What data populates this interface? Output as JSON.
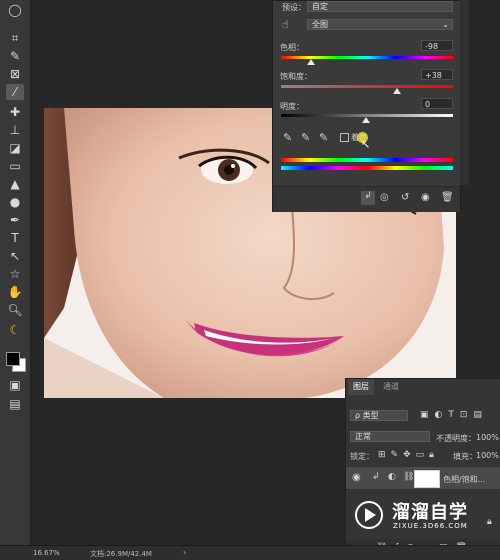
{
  "properties": {
    "preset_label": "预设：",
    "preset_value": "自定",
    "channel_value": "全图",
    "hue_label": "色相：",
    "hue_value": "-98",
    "saturation_label": "饱和度：",
    "saturation_value": "+38",
    "lightness_label": "明度：",
    "lightness_value": "0",
    "colorize_label": "着色"
  },
  "layers": {
    "tab_layers": "图层",
    "tab_channels": "通道",
    "filter_kind": "ρ 类型",
    "blend_mode": "正常",
    "opacity_label": "不透明度：",
    "opacity_value": "100%",
    "lock_label": "锁定：",
    "fill_label": "填充：",
    "fill_value": "100%",
    "layer_name": "色相/饱和..."
  },
  "watermark": {
    "brand": "溜溜自学",
    "url": "ZIXUE.3D66.COM"
  },
  "status": {
    "zoom": "16.67%",
    "doc": "文档:26.9M/42.4M"
  },
  "colors": {
    "foreground": "#000000",
    "background": "#ffffff",
    "lips": "#d9428d"
  }
}
